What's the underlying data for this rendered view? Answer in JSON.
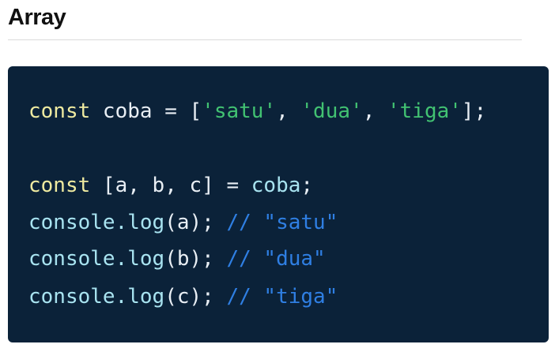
{
  "section": {
    "title": "Array"
  },
  "code": {
    "lines": [
      {
        "tokens": [
          {
            "type": "keyword",
            "text": "const"
          },
          {
            "type": "plain",
            "text": " coba = ["
          },
          {
            "type": "string",
            "text": "'satu'"
          },
          {
            "type": "plain",
            "text": ", "
          },
          {
            "type": "string",
            "text": "'dua'"
          },
          {
            "type": "plain",
            "text": ", "
          },
          {
            "type": "string",
            "text": "'tiga'"
          },
          {
            "type": "plain",
            "text": "];"
          }
        ]
      },
      {
        "tokens": [
          {
            "type": "keyword",
            "text": "const"
          },
          {
            "type": "plain",
            "text": " [a, b, c] = "
          },
          {
            "type": "builtin",
            "text": "coba"
          },
          {
            "type": "plain",
            "text": ";"
          }
        ]
      },
      {
        "tokens": [
          {
            "type": "builtin",
            "text": "console.log"
          },
          {
            "type": "plain",
            "text": "(a); "
          },
          {
            "type": "comment",
            "text": "// \"satu\""
          }
        ]
      },
      {
        "tokens": [
          {
            "type": "builtin",
            "text": "console.log"
          },
          {
            "type": "plain",
            "text": "(b); "
          },
          {
            "type": "comment",
            "text": "// \"dua\""
          }
        ]
      },
      {
        "tokens": [
          {
            "type": "builtin",
            "text": "console.log"
          },
          {
            "type": "plain",
            "text": "(c); "
          },
          {
            "type": "comment",
            "text": "// \"tiga\""
          }
        ]
      }
    ]
  },
  "colors": {
    "code_background": "#0b2239",
    "keyword": "#eeeaa0",
    "string": "#42c272",
    "builtin": "#a8e3f0",
    "comment": "#2f7fe3",
    "plain": "#e8eef4"
  }
}
